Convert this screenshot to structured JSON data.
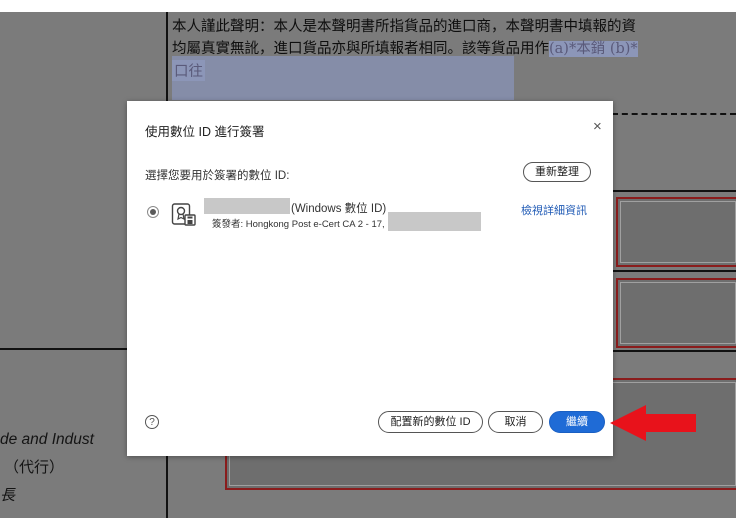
{
  "document": {
    "declaration_line1": "本人謹此聲明：本人是本聲明書所指貨品的進口商，本聲明書中填報的資",
    "declaration_line2": "均屬真實無訛，進口貨品亦與所填報者相同。該等貨品用作",
    "declaration_line2_highlight": "(a)*本銷 (b)*",
    "declaration_line3": "口往",
    "left_text1": "de and Indust",
    "left_text2": "（代行）",
    "left_text3": "長"
  },
  "dialog": {
    "title": "使用數位 ID 進行簽署",
    "close_symbol": "×",
    "prompt": "選擇您要用於簽署的數位 ID:",
    "refresh_label": "重新整理",
    "certificate": {
      "id_type": "(Windows 數位 ID)",
      "issuer": "簽發者: Hongkong Post e-Cert CA 2 - 17,",
      "icon": "certificate-icon"
    },
    "details_link": "檢視詳細資訊",
    "help_symbol": "?",
    "buttons": {
      "configure": "配置新的數位 ID",
      "cancel": "取消",
      "continue": "繼續"
    }
  },
  "colors": {
    "primary": "#1f6bd6",
    "link": "#1f5ab5",
    "annotation_arrow": "#e8121b",
    "doc_border": "#8a1c1c"
  }
}
